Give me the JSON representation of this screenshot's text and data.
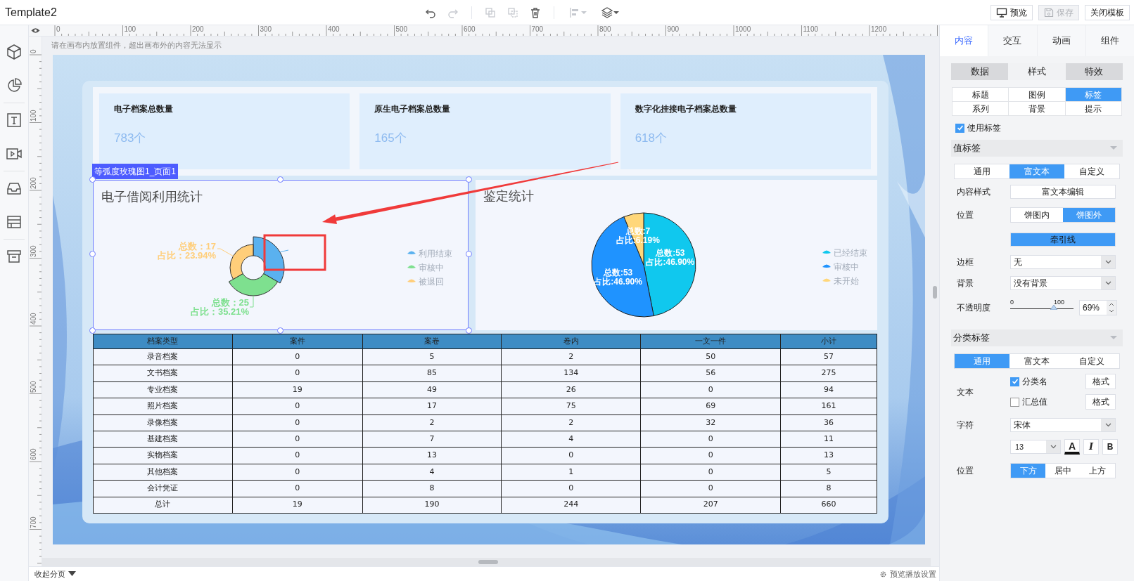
{
  "window": {
    "title": "Template2"
  },
  "toolbar": [
    {
      "kind": "undo",
      "disabled": false
    },
    {
      "kind": "redo",
      "disabled": true
    },
    {
      "kind": "copy",
      "disabled": true
    },
    {
      "kind": "paste",
      "disabled": true
    },
    {
      "kind": "delete",
      "disabled": false
    },
    {
      "kind": "align",
      "disabled": true
    },
    {
      "kind": "layers",
      "disabled": false
    }
  ],
  "actions": [
    {
      "label": "预览",
      "kind": "preview",
      "disabled": false
    },
    {
      "label": "保存",
      "kind": "save",
      "disabled": true
    },
    {
      "label": "关闭模板",
      "kind": "plain",
      "disabled": false
    }
  ],
  "ruler": {
    "x_labels": [
      "0",
      "100",
      "200",
      "300",
      "400",
      "500",
      "600",
      "700",
      "800",
      "900",
      "1000",
      "1100",
      "1200"
    ],
    "y_labels": [
      "0",
      "100",
      "200",
      "300",
      "400",
      "500",
      "600",
      "700"
    ]
  },
  "canvas": {
    "hint": "请在画布内放置组件，超出画布外的内容无法显示",
    "selection_label": "等弧度玫瑰图1_页面1",
    "cards": [
      {
        "title": "电子档案总数量",
        "value": "783个"
      },
      {
        "title": "原生电子档案总数量",
        "value": "165个"
      },
      {
        "title": "数字化挂接电子档案总数量",
        "value": "618个"
      }
    ],
    "charts": [
      {
        "title": "电子借阅利用统计",
        "selected": true,
        "kind": "rose",
        "slices": [
          {
            "name": "利用结束",
            "color": "#5ab1ef"
          },
          {
            "name": "审核中",
            "color": "#7ee08f",
            "value_label": [
              "总数：25",
              "占比：35.21%"
            ]
          },
          {
            "name": "被退回",
            "color": "#ffce7a",
            "value_label": [
              "总数：17",
              "占比：23.94%"
            ]
          }
        ]
      },
      {
        "title": "鉴定统计",
        "selected": false,
        "chart_data": {
          "type": "pie",
          "categories": [
            "已经结束",
            "审核中",
            "未开始"
          ],
          "colors": [
            "#10c8ee",
            "#1f93ff",
            "#ffd77a"
          ],
          "values": [
            46.9,
            46.9,
            6.19
          ],
          "legend": "right",
          "value_labels": [
            [
              "总数:53",
              "占比:46.90%"
            ],
            [
              "总数:53",
              "占比:46.90%"
            ],
            [
              "总数:7",
              "占比:6.19%"
            ]
          ]
        }
      }
    ],
    "table": {
      "columns": [
        "档案类型",
        "案件",
        "案卷",
        "卷内",
        "一文一件",
        "小计"
      ],
      "rows": [
        [
          "录音档案",
          "0",
          "5",
          "2",
          "50",
          "57"
        ],
        [
          "文书档案",
          "0",
          "85",
          "134",
          "56",
          "275"
        ],
        [
          "专业档案",
          "19",
          "49",
          "26",
          "0",
          "94"
        ],
        [
          "照片档案",
          "0",
          "17",
          "75",
          "69",
          "161"
        ],
        [
          "录像档案",
          "0",
          "2",
          "2",
          "32",
          "36"
        ],
        [
          "基建档案",
          "0",
          "7",
          "4",
          "0",
          "11"
        ],
        [
          "实物档案",
          "0",
          "13",
          "0",
          "0",
          "13"
        ],
        [
          "其他档案",
          "0",
          "4",
          "1",
          "0",
          "5"
        ],
        [
          "会计凭证",
          "0",
          "8",
          "0",
          "0",
          "8"
        ],
        [
          "总计",
          "19",
          "190",
          "244",
          "207",
          "660"
        ]
      ]
    }
  },
  "panel": {
    "tabs": [
      {
        "label": "内容",
        "selected": true
      },
      {
        "label": "交互",
        "selected": false
      },
      {
        "label": "动画",
        "selected": false
      },
      {
        "label": "组件",
        "selected": false
      }
    ],
    "subtabs": [
      {
        "label": "数据",
        "selected": false
      },
      {
        "label": "样式",
        "selected": true
      },
      {
        "label": "特效",
        "selected": false
      }
    ],
    "sections": [
      {
        "label": "标题",
        "selected": false
      },
      {
        "label": "图例",
        "selected": false
      },
      {
        "label": "标签",
        "selected": true
      },
      {
        "label": "系列",
        "selected": false
      },
      {
        "label": "背景",
        "selected": false
      },
      {
        "label": "提示",
        "selected": false
      }
    ],
    "use_label": {
      "label": "使用标签",
      "checked": true
    },
    "value_label": {
      "title": "值标签",
      "modes": [
        {
          "label": "通用",
          "selected": false
        },
        {
          "label": "富文本",
          "selected": true
        },
        {
          "label": "自定义",
          "selected": false
        }
      ],
      "content_style_label": "内容样式",
      "content_button": "富文本编辑",
      "position_label": "位置",
      "positions": [
        {
          "label": "饼图内",
          "selected": false
        },
        {
          "label": "饼图外",
          "selected": true
        }
      ],
      "leader_line": {
        "label": "牵引线",
        "on": true
      },
      "border_label": "边框",
      "border": "无",
      "background_label": "背景",
      "background": "没有背景",
      "opacity_label": "不透明度",
      "opacity_min": "0",
      "opacity_max": "100",
      "opacity": {
        "level": 0.69,
        "value": "69%"
      }
    },
    "category_label": {
      "title": "分类标签",
      "modes": [
        {
          "label": "通用",
          "selected": true
        },
        {
          "label": "富文本",
          "selected": false
        },
        {
          "label": "自定义",
          "selected": false
        }
      ],
      "text_label": "文本",
      "options": [
        {
          "label": "分类名",
          "checked": true,
          "button": "格式"
        },
        {
          "label": "汇总值",
          "checked": false,
          "button": "格式"
        }
      ],
      "font_label": "字符",
      "font": "宋体",
      "size": "13",
      "style_buttons": [
        {
          "label": "A",
          "kind": "color"
        },
        {
          "label": "I",
          "kind": "italic"
        },
        {
          "label": "B",
          "kind": "bold"
        }
      ],
      "position_label": "位置",
      "positions": [
        {
          "label": "下方",
          "selected": true
        },
        {
          "label": "居中",
          "selected": false
        },
        {
          "label": "上方",
          "selected": false
        }
      ]
    }
  },
  "footer": {
    "collapse": "收起分页",
    "settings": "预览播放设置"
  }
}
